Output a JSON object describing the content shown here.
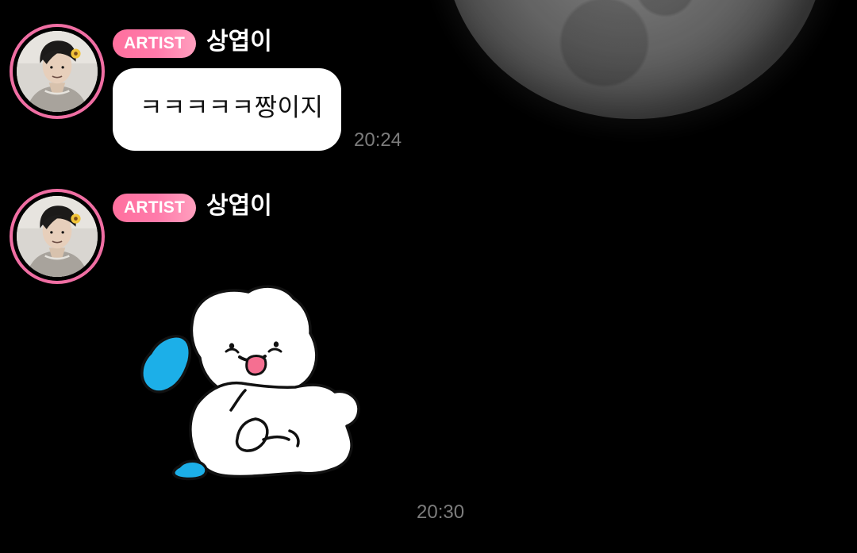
{
  "background": {
    "moon_icon": "moon-icon",
    "colors": {
      "background": "#000000",
      "avatar_ring": "#f06ea3",
      "badge_start": "#ff709e",
      "badge_end": "#ff9fbe",
      "bubble": "#ffffff",
      "time_text": "#7c7c7c"
    }
  },
  "messages": [
    {
      "avatar_icon": "profile-avatar-icon",
      "badge": "ARTIST",
      "name": "상엽이",
      "text": "ㅋㅋㅋㅋㅋ짱이지",
      "time": "20:24"
    },
    {
      "avatar_icon": "profile-avatar-icon",
      "badge": "ARTIST",
      "name": "상엽이",
      "sticker_icon": "puppy-sticker-icon",
      "time": "20:30"
    }
  ]
}
